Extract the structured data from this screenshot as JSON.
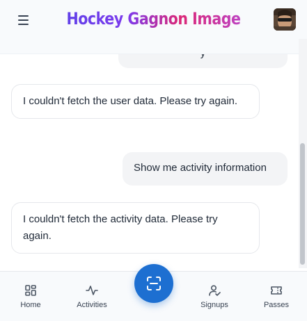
{
  "header": {
    "title": "Hockey Gagnon Image"
  },
  "messages": [
    {
      "role": "user",
      "text": "y"
    },
    {
      "role": "bot",
      "text": "I couldn't fetch the user data. Please try again."
    },
    {
      "role": "user",
      "text": "Show me activity information"
    },
    {
      "role": "bot",
      "text": "I couldn't fetch the activity data. Please try again."
    }
  ],
  "nav": {
    "home": "Home",
    "activities": "Activities",
    "signups": "Signups",
    "passes": "Passes"
  },
  "colors": {
    "accent": "#1d6fd1",
    "brand_gradient": [
      "#4f46e5",
      "#db2777",
      "#a855f7"
    ]
  }
}
